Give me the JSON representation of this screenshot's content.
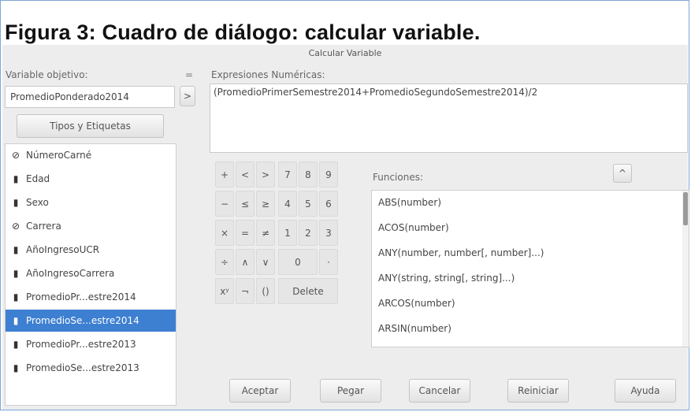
{
  "caption": "Figura 3: Cuadro de diálogo: calcular variable.",
  "dialog": {
    "title": "Calcular Variable",
    "target_label": "Variable objetivo:",
    "equals": "=",
    "target_value": "PromedioPonderado2014",
    "types_button": "Tipos y Etiquetas",
    "arrow_button": ">",
    "expr_label": "Expresiones Numéricas:",
    "expression": "(PromedioPrimerSemestre2014+PromedioSegundoSemestre2014)/2",
    "variables": [
      {
        "icon": "⊘",
        "icon_name": "nominal-icon",
        "label": "NúmeroCarné",
        "selected": false
      },
      {
        "icon": "▮",
        "icon_name": "scale-icon",
        "label": "Edad",
        "selected": false
      },
      {
        "icon": "▮",
        "icon_name": "scale-icon",
        "label": "Sexo",
        "selected": false
      },
      {
        "icon": "⊘",
        "icon_name": "nominal-icon",
        "label": "Carrera",
        "selected": false
      },
      {
        "icon": "▮",
        "icon_name": "scale-icon",
        "label": "AñoIngresoUCR",
        "selected": false
      },
      {
        "icon": "▮",
        "icon_name": "scale-icon",
        "label": "AñoIngresoCarrera",
        "selected": false
      },
      {
        "icon": "▮",
        "icon_name": "scale-icon",
        "label": "PromedioPr...estre2014",
        "selected": false
      },
      {
        "icon": "▮",
        "icon_name": "scale-icon",
        "label": "PromedioSe...estre2014",
        "selected": true
      },
      {
        "icon": "▮",
        "icon_name": "scale-icon",
        "label": "PromedioPr...estre2013",
        "selected": false
      },
      {
        "icon": "▮",
        "icon_name": "scale-icon",
        "label": "PromedioSe...estre2013",
        "selected": false
      }
    ],
    "keypad": {
      "row1": [
        "+",
        "<",
        ">",
        "7",
        "8",
        "9"
      ],
      "row2": [
        "−",
        "≤",
        "≥",
        "4",
        "5",
        "6"
      ],
      "row3": [
        "×",
        "=",
        "≠",
        "1",
        "2",
        "3"
      ],
      "row4": [
        "÷",
        "∧",
        "∨",
        "0",
        "·"
      ],
      "row5": [
        "xʸ",
        "¬",
        "()",
        "Delete"
      ]
    },
    "functions_label": "Funciones:",
    "functions_collapse": "^",
    "functions": [
      "ABS(number)",
      "ACOS(number)",
      "ANY(number, number[, number]...)",
      "ANY(string, string[, string]...)",
      "ARCOS(number)",
      "ARSIN(number)"
    ],
    "buttons": {
      "accept": "Aceptar",
      "paste": "Pegar",
      "cancel": "Cancelar",
      "reset": "Reiniciar",
      "help": "Ayuda"
    },
    "colors": {
      "selection": "#3d7fd1",
      "dialog_bg": "#ededed"
    }
  }
}
